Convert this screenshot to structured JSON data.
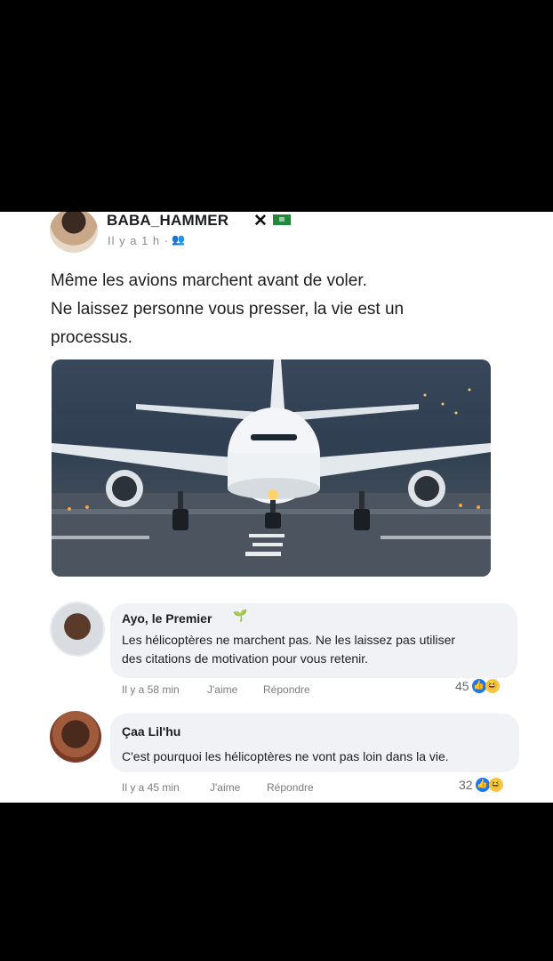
{
  "post": {
    "author": "BABA_HAMMER",
    "badge": "✕",
    "time": "Il y a 1 h ·",
    "audience_icon": "friends-icon",
    "lines": [
      "Même les avions marchent avant de voler.",
      "Ne laissez personne vous presser, la vie est un",
      "processus."
    ]
  },
  "comments": [
    {
      "name": "Ayo, le Premier",
      "text_lines": [
        "Les hélicoptères ne marchent pas. Ne les laissez pas utiliser",
        "des citations de motivation pour vous retenir."
      ],
      "time": "Il y a 58 min",
      "like_label": "J'aime",
      "reply_label": "Répondre",
      "reaction_count": "45"
    },
    {
      "name": "Çaa Lil'hu",
      "text_lines": [
        "C'est pourquoi les hélicoptères ne vont pas loin dans la vie."
      ],
      "time": "Il y a 45 min",
      "like_label": "J'aime",
      "reply_label": "Répondre",
      "reaction_count": "32"
    }
  ],
  "colors": {
    "background": "#000000",
    "card": "#ffffff",
    "bubble": "#f0f2f5",
    "like_blue": "#1877f2"
  }
}
